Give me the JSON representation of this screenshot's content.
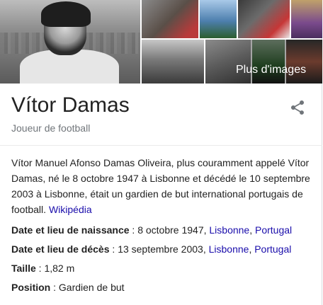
{
  "gallery": {
    "more_images_label": "Plus d'images"
  },
  "entity": {
    "title": "Vítor Damas",
    "subtitle": "Joueur de football"
  },
  "description": {
    "text": "Vítor Manuel Afonso Damas Oliveira, plus couramment appelé Vítor Damas, né le 8 octobre 1947 à Lisbonne et décédé le 10 septembre 2003 à Lisbonne, était un gardien de but international portugais de football.",
    "source_link": "Wikipédia"
  },
  "facts": {
    "birth": {
      "label": "Date et lieu de naissance",
      "separator": " : ",
      "value": "8 octobre 1947, ",
      "link1": "Lisbonne",
      "comma": ", ",
      "link2": "Portugal"
    },
    "death": {
      "label": "Date et lieu de décès",
      "separator": " : ",
      "value": "13 septembre 2003, ",
      "link1": "Lisbonne",
      "comma": ", ",
      "link2": "Portugal"
    },
    "height": {
      "label": "Taille",
      "separator": " : ",
      "value": "1,82 m"
    },
    "position": {
      "label": "Position",
      "separator": " : ",
      "value": "Gardien de but"
    }
  },
  "colors": {
    "link": "#1a0dab",
    "subtitle": "#70757a",
    "text": "#222222"
  },
  "icons": {
    "share": "share-icon"
  }
}
